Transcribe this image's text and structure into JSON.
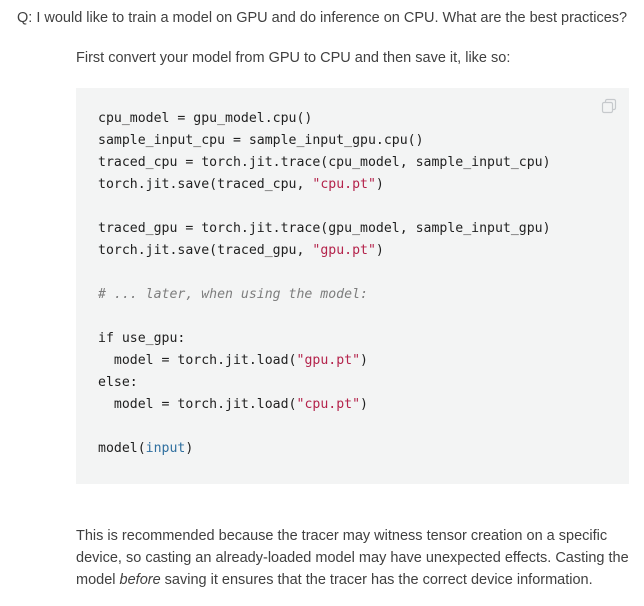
{
  "question": "Q: I would like to train a model on GPU and do inference on CPU. What are the best practices?",
  "intro": "First convert your model from GPU to CPU and then save it, like so:",
  "code": {
    "lines": [
      [
        {
          "t": "cpu_model = gpu_model.cpu()",
          "c": ""
        }
      ],
      [
        {
          "t": "sample_input_cpu = sample_input_gpu.cpu()",
          "c": ""
        }
      ],
      [
        {
          "t": "traced_cpu = torch.jit.trace(cpu_model, sample_input_cpu)",
          "c": ""
        }
      ],
      [
        {
          "t": "torch.jit.save(traced_cpu, ",
          "c": ""
        },
        {
          "t": "\"cpu.pt\"",
          "c": "str"
        },
        {
          "t": ")",
          "c": ""
        }
      ],
      [],
      [
        {
          "t": "traced_gpu = torch.jit.trace(gpu_model, sample_input_gpu)",
          "c": ""
        }
      ],
      [
        {
          "t": "torch.jit.save(traced_gpu, ",
          "c": ""
        },
        {
          "t": "\"gpu.pt\"",
          "c": "str"
        },
        {
          "t": ")",
          "c": ""
        }
      ],
      [],
      [
        {
          "t": "# ... later, when using the model:",
          "c": "cmt"
        }
      ],
      [],
      [
        {
          "t": "if use_gpu:",
          "c": "kw"
        }
      ],
      [
        {
          "t": "  model = torch.jit.load(",
          "c": ""
        },
        {
          "t": "\"gpu.pt\"",
          "c": "str"
        },
        {
          "t": ")",
          "c": ""
        }
      ],
      [
        {
          "t": "else:",
          "c": "kw"
        }
      ],
      [
        {
          "t": "  model = torch.jit.load(",
          "c": ""
        },
        {
          "t": "\"cpu.pt\"",
          "c": "str"
        },
        {
          "t": ")",
          "c": ""
        }
      ],
      [],
      [
        {
          "t": "model(",
          "c": ""
        },
        {
          "t": "input",
          "c": "bi"
        },
        {
          "t": ")",
          "c": ""
        }
      ]
    ]
  },
  "outro": {
    "before": "This is recommended because the tracer may witness tensor creation on a specific device, so casting an already-loaded model may have unexpected effects. Casting the model ",
    "emphasis": "before",
    "after": " saving it ensures that the tracer has the correct device information."
  },
  "icons": {
    "copy": "copy-icon"
  }
}
